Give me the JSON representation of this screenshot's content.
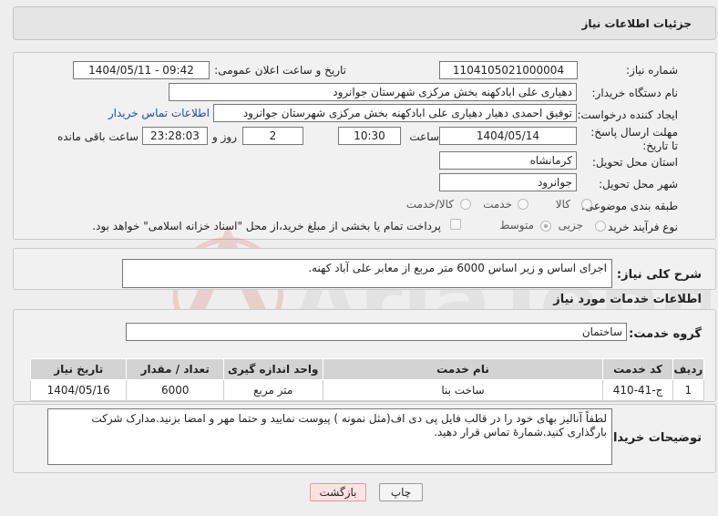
{
  "header": {
    "title": "جزئیات اطلاعات نیاز"
  },
  "form": {
    "need_number_label": "شماره نیاز:",
    "need_number": "1104105021000004",
    "announce_label": "تاریخ و ساعت اعلان عمومی:",
    "announce_value": "1404/05/11 - 09:42",
    "buyer_org_label": "نام دستگاه خریدار:",
    "buyer_org": "دهیاری علی ابادکهنه بخش مرکزی شهرستان جوانرود",
    "creator_label": "ایجاد کننده درخواست:",
    "creator": "توفیق احمدی دهیار دهیاری علی ابادکهنه بخش مرکزی شهرستان جوانرود",
    "contact_link": "اطلاعات تماس خریدار",
    "deadline_label": "مهلت ارسال پاسخ: تا تاریخ:",
    "deadline_date": "1404/05/14",
    "time_label": "ساعت",
    "deadline_time": "10:30",
    "days_value": "2",
    "days_label": "روز و",
    "remaining_time": "23:28:03",
    "remaining_label": "ساعت باقی مانده",
    "province_label": "استان محل تحویل:",
    "province": "کرمانشاه",
    "city_label": "شهر محل تحویل:",
    "city": "جوانرود",
    "category_label": "طبقه بندی موضوعی:",
    "category_options": [
      "کالا",
      "خدمت",
      "کالا/خدمت"
    ],
    "process_label": "نوع فرآیند خرید :",
    "process_options": [
      "جزیی",
      "متوسط"
    ],
    "payment_note": "پرداخت تمام یا بخشی از مبلغ خرید،از محل \"اسناد خزانه اسلامی\" خواهد بود."
  },
  "summary": {
    "label": "شرح کلی نیاز:",
    "text": "اجرای اساس و زیر اساس 6000 متر مربع از معابر علی آباد کهنه."
  },
  "services": {
    "title": "اطلاعات خدمات مورد نیاز",
    "group_label": "گروه خدمت:",
    "group_value": "ساختمان",
    "table": {
      "headers": [
        "ردیف",
        "کد خدمت",
        "نام خدمت",
        "واحد اندازه گیری",
        "تعداد / مقدار",
        "تاریخ نیاز"
      ],
      "rows": [
        [
          "1",
          "ج-41-410",
          "ساخت بنا",
          "متر مربع",
          "6000",
          "1404/05/16"
        ]
      ]
    }
  },
  "buyer_notes": {
    "label": "توضیحات خریدار:",
    "text": "لطفاً آنالیز بهای خود را در قالب فایل پی دی اف(مثل نمونه ) پیوست نمایید و حتما مهر و امضا بزنید.مدارک شرکت بارگذاری کنید.شمارهٔ تماس قرار دهید."
  },
  "buttons": {
    "print": "چاپ",
    "back": "بازگشت"
  },
  "watermark": {
    "text": "AriaTender.neT"
  }
}
